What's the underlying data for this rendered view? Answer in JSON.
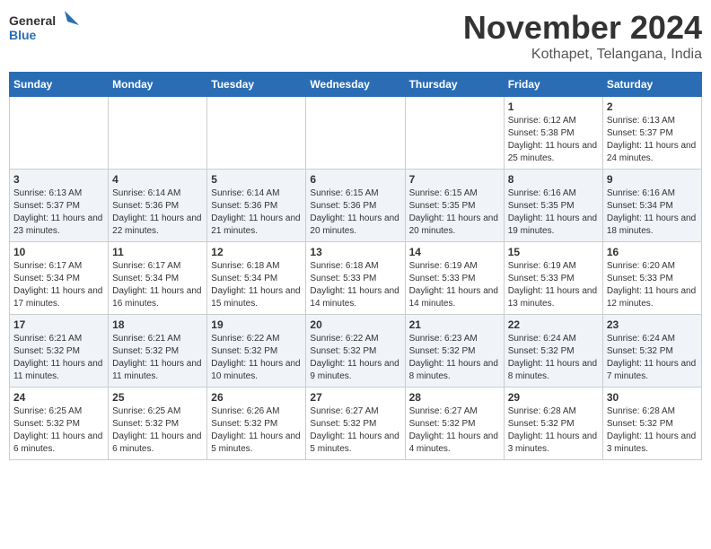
{
  "logo": {
    "line1": "General",
    "line2": "Blue"
  },
  "header": {
    "month": "November 2024",
    "location": "Kothapet, Telangana, India"
  },
  "weekdays": [
    "Sunday",
    "Monday",
    "Tuesday",
    "Wednesday",
    "Thursday",
    "Friday",
    "Saturday"
  ],
  "weeks": [
    [
      {
        "day": "",
        "info": ""
      },
      {
        "day": "",
        "info": ""
      },
      {
        "day": "",
        "info": ""
      },
      {
        "day": "",
        "info": ""
      },
      {
        "day": "",
        "info": ""
      },
      {
        "day": "1",
        "info": "Sunrise: 6:12 AM\nSunset: 5:38 PM\nDaylight: 11 hours and 25 minutes."
      },
      {
        "day": "2",
        "info": "Sunrise: 6:13 AM\nSunset: 5:37 PM\nDaylight: 11 hours and 24 minutes."
      }
    ],
    [
      {
        "day": "3",
        "info": "Sunrise: 6:13 AM\nSunset: 5:37 PM\nDaylight: 11 hours and 23 minutes."
      },
      {
        "day": "4",
        "info": "Sunrise: 6:14 AM\nSunset: 5:36 PM\nDaylight: 11 hours and 22 minutes."
      },
      {
        "day": "5",
        "info": "Sunrise: 6:14 AM\nSunset: 5:36 PM\nDaylight: 11 hours and 21 minutes."
      },
      {
        "day": "6",
        "info": "Sunrise: 6:15 AM\nSunset: 5:36 PM\nDaylight: 11 hours and 20 minutes."
      },
      {
        "day": "7",
        "info": "Sunrise: 6:15 AM\nSunset: 5:35 PM\nDaylight: 11 hours and 20 minutes."
      },
      {
        "day": "8",
        "info": "Sunrise: 6:16 AM\nSunset: 5:35 PM\nDaylight: 11 hours and 19 minutes."
      },
      {
        "day": "9",
        "info": "Sunrise: 6:16 AM\nSunset: 5:34 PM\nDaylight: 11 hours and 18 minutes."
      }
    ],
    [
      {
        "day": "10",
        "info": "Sunrise: 6:17 AM\nSunset: 5:34 PM\nDaylight: 11 hours and 17 minutes."
      },
      {
        "day": "11",
        "info": "Sunrise: 6:17 AM\nSunset: 5:34 PM\nDaylight: 11 hours and 16 minutes."
      },
      {
        "day": "12",
        "info": "Sunrise: 6:18 AM\nSunset: 5:34 PM\nDaylight: 11 hours and 15 minutes."
      },
      {
        "day": "13",
        "info": "Sunrise: 6:18 AM\nSunset: 5:33 PM\nDaylight: 11 hours and 14 minutes."
      },
      {
        "day": "14",
        "info": "Sunrise: 6:19 AM\nSunset: 5:33 PM\nDaylight: 11 hours and 14 minutes."
      },
      {
        "day": "15",
        "info": "Sunrise: 6:19 AM\nSunset: 5:33 PM\nDaylight: 11 hours and 13 minutes."
      },
      {
        "day": "16",
        "info": "Sunrise: 6:20 AM\nSunset: 5:33 PM\nDaylight: 11 hours and 12 minutes."
      }
    ],
    [
      {
        "day": "17",
        "info": "Sunrise: 6:21 AM\nSunset: 5:32 PM\nDaylight: 11 hours and 11 minutes."
      },
      {
        "day": "18",
        "info": "Sunrise: 6:21 AM\nSunset: 5:32 PM\nDaylight: 11 hours and 11 minutes."
      },
      {
        "day": "19",
        "info": "Sunrise: 6:22 AM\nSunset: 5:32 PM\nDaylight: 11 hours and 10 minutes."
      },
      {
        "day": "20",
        "info": "Sunrise: 6:22 AM\nSunset: 5:32 PM\nDaylight: 11 hours and 9 minutes."
      },
      {
        "day": "21",
        "info": "Sunrise: 6:23 AM\nSunset: 5:32 PM\nDaylight: 11 hours and 8 minutes."
      },
      {
        "day": "22",
        "info": "Sunrise: 6:24 AM\nSunset: 5:32 PM\nDaylight: 11 hours and 8 minutes."
      },
      {
        "day": "23",
        "info": "Sunrise: 6:24 AM\nSunset: 5:32 PM\nDaylight: 11 hours and 7 minutes."
      }
    ],
    [
      {
        "day": "24",
        "info": "Sunrise: 6:25 AM\nSunset: 5:32 PM\nDaylight: 11 hours and 6 minutes."
      },
      {
        "day": "25",
        "info": "Sunrise: 6:25 AM\nSunset: 5:32 PM\nDaylight: 11 hours and 6 minutes."
      },
      {
        "day": "26",
        "info": "Sunrise: 6:26 AM\nSunset: 5:32 PM\nDaylight: 11 hours and 5 minutes."
      },
      {
        "day": "27",
        "info": "Sunrise: 6:27 AM\nSunset: 5:32 PM\nDaylight: 11 hours and 5 minutes."
      },
      {
        "day": "28",
        "info": "Sunrise: 6:27 AM\nSunset: 5:32 PM\nDaylight: 11 hours and 4 minutes."
      },
      {
        "day": "29",
        "info": "Sunrise: 6:28 AM\nSunset: 5:32 PM\nDaylight: 11 hours and 3 minutes."
      },
      {
        "day": "30",
        "info": "Sunrise: 6:28 AM\nSunset: 5:32 PM\nDaylight: 11 hours and 3 minutes."
      }
    ]
  ]
}
